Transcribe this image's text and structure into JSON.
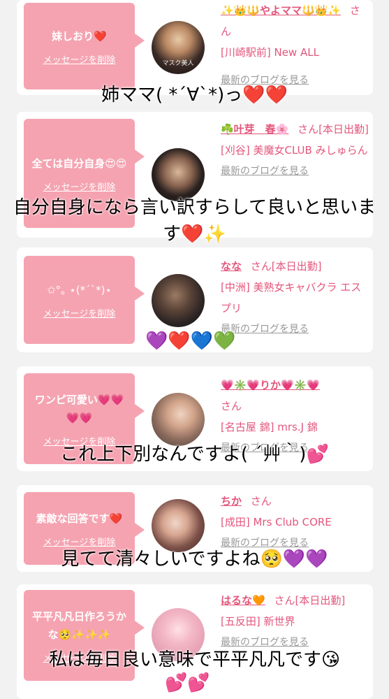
{
  "cards": [
    {
      "message": "妹しおり❤️",
      "delete_label": "メッセージを削除",
      "name": "✨👑🔱やよママ🔱👑✨",
      "suffix": "さん",
      "shop": "[川崎駅前] New ALL",
      "blog_label": "最新のブログを見る",
      "avatar_text": "マスク美人"
    },
    {
      "message": "全ては自分自身😍😍",
      "delete_label": "メッセージを削除",
      "name": "☘️叶芽　春🌸",
      "suffix": "さん[本日出勤]",
      "shop": "[刈谷] 美魔女CLUB みしゅらん",
      "blog_label": "最新のブログを見る"
    },
    {
      "message": "✩°｡ ⋆(*ˊˋ*)⋆",
      "delete_label": "メッセージを削除",
      "name": "なな",
      "suffix": "さん[本日出勤]",
      "shop": "[中洲] 美熟女キャバクラ エスプリ",
      "blog_label": "最新のブログを見る"
    },
    {
      "message": "ワンピ可愛い💗💗💗💗",
      "delete_label": "メッセージを削除",
      "name": "💗✳️💗りか💗✳️💗",
      "suffix": "さん",
      "shop": "[名古屋 錦] mrs.J 錦",
      "blog_label": "最新のブログを見る"
    },
    {
      "message": "素敵な回答です❤️",
      "delete_label": "メッセージを削除",
      "name": "ちか",
      "suffix": "さん",
      "shop": "[成田] Mrs Club CORE",
      "blog_label": "最新のブログを見る"
    },
    {
      "message": "平平凡凡日作ろうかな🥺✨✨✨",
      "delete_label": "メッセージを削除",
      "name": "はるな🧡",
      "suffix": "さん[本日出勤]",
      "shop": "[五反田] 新世界",
      "blog_label": "最新のブログを見る"
    }
  ],
  "overlays": [
    {
      "text": "姉ママ( *´∀`*)っ",
      "emoji": "❤️❤️"
    },
    {
      "text": "自分自身になら言い訳すらして良いと思います",
      "emoji": "❤️✨"
    },
    {
      "emoji": "💜❤️💙💚"
    },
    {
      "text": "これ上下別なんですよ( ´艸｀)",
      "emoji": "💕"
    },
    {
      "text": "見てて清々しいですよね",
      "emoji": "🥺💜💜"
    },
    {
      "text": "私は毎日良い意味で平平凡凡です",
      "emoji": "😘"
    }
  ]
}
